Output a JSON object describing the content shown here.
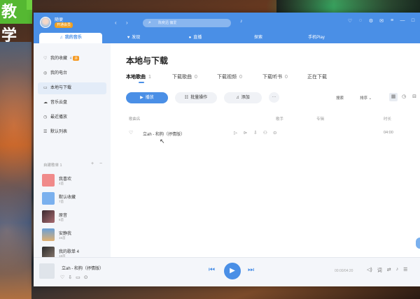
{
  "overlay": {
    "badge_text": "教学"
  },
  "titlebar": {
    "username": "随便",
    "vip_label": "开通会员",
    "search_placeholder": "陈奕迅 偏爱",
    "window_controls": [
      "♡",
      "◌",
      "⚙",
      "✉",
      "≡",
      "—",
      "□"
    ]
  },
  "tabs": [
    {
      "label": "我的音乐",
      "icon": "music-note-icon",
      "glyph": "♫"
    },
    {
      "label": "发现",
      "icon": "discover-icon",
      "glyph": "♥"
    },
    {
      "label": "直播",
      "icon": "live-icon",
      "glyph": "●"
    },
    {
      "label": "探索",
      "icon": "",
      "glyph": ""
    },
    {
      "label": "手机Play",
      "icon": "",
      "glyph": ""
    }
  ],
  "sidebar": {
    "nav_items": [
      {
        "label": "我的收藏",
        "glyph": "♡",
        "count": "4",
        "tag": "开"
      },
      {
        "label": "我的电台",
        "glyph": "◎",
        "count": "",
        "tag": ""
      },
      {
        "label": "本地与下载",
        "glyph": "▭",
        "count": "",
        "tag": ""
      },
      {
        "label": "音乐云盘",
        "glyph": "☁",
        "count": "",
        "tag": ""
      },
      {
        "label": "最近播放",
        "glyph": "◷",
        "count": "",
        "tag": ""
      },
      {
        "label": "默认列表",
        "glyph": "☰",
        "count": "",
        "tag": ""
      }
    ],
    "section_label": "自建歌单 1",
    "playlists": [
      {
        "name": "我喜欢",
        "count": "4首",
        "color": "#f08a8a"
      },
      {
        "name": "默认收藏",
        "count": "7首",
        "color": "#7ab0ee"
      },
      {
        "name": "原音",
        "count": "6首",
        "color": "#3a2a30"
      },
      {
        "name": "安静我",
        "count": "15首",
        "color": "#6aa0d8"
      },
      {
        "name": "我的歌单 4",
        "count": "18首",
        "color": "#2a2a2a"
      }
    ]
  },
  "main": {
    "title": "本地与下载",
    "subtabs": [
      {
        "label": "本地歌曲",
        "count": "1"
      },
      {
        "label": "下载歌曲",
        "count": "0"
      },
      {
        "label": "下载视频",
        "count": "0"
      },
      {
        "label": "下载听书",
        "count": "0"
      },
      {
        "label": "正在下载",
        "count": ""
      }
    ],
    "buttons": {
      "play": "播放",
      "batch": "批量操作",
      "add": "添加",
      "more": "···"
    },
    "tools": {
      "sort_label": "搜索",
      "order_label": "排序 ⌄"
    },
    "columns": [
      "歌曲名",
      "歌手",
      "专辑",
      "时长"
    ],
    "songs": [
      {
        "title": "立ah - 和狗（抒情版）",
        "duration": "04:00"
      }
    ]
  },
  "player": {
    "title": "立ah - 和狗（抒情版）",
    "time": "00:00/04:20"
  }
}
